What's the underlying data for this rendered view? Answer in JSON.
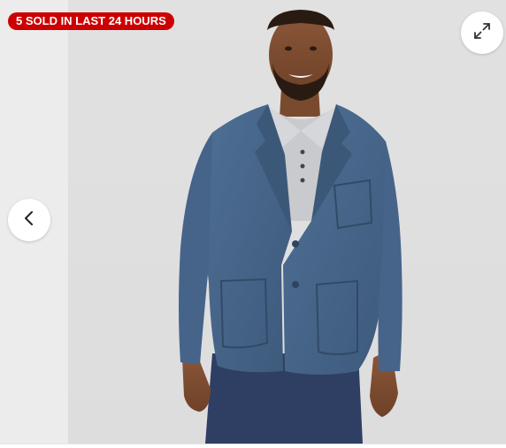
{
  "badge": {
    "text": "5 SOLD IN LAST 24 HOURS",
    "color": "#cc0000"
  },
  "controls": {
    "expand_icon": "expand-icon",
    "prev_icon": "chevron-left-icon"
  },
  "image": {
    "subject": "model-wearing-blue-knit-blazer"
  }
}
